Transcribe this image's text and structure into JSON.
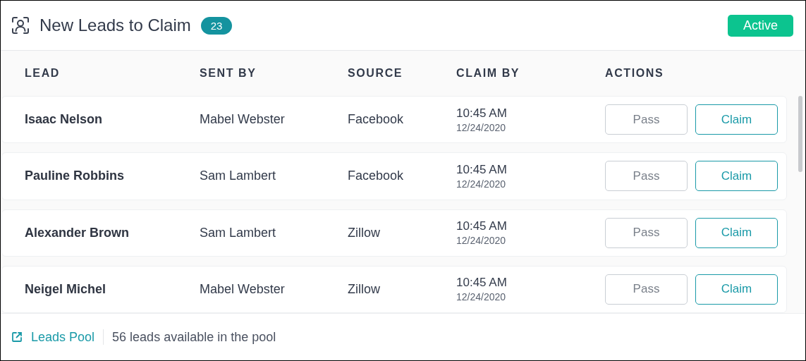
{
  "header": {
    "title": "New Leads to Claim",
    "count": "23",
    "status": "Active"
  },
  "table": {
    "columns": [
      "LEAD",
      "SENT BY",
      "SOURCE",
      "CLAIM BY",
      "ACTIONS"
    ],
    "rows": [
      {
        "lead": "Isaac Nelson",
        "sent_by": "Mabel Webster",
        "source": "Facebook",
        "time": "10:45 AM",
        "date": "12/24/2020",
        "actions": [
          {
            "label": "Pass",
            "kind": "secondary"
          },
          {
            "label": "Claim",
            "kind": "primary"
          }
        ]
      },
      {
        "lead": "Pauline Robbins",
        "sent_by": "Sam Lambert",
        "source": "Facebook",
        "time": "10:45 AM",
        "date": "12/24/2020",
        "actions": [
          {
            "label": "Pass",
            "kind": "secondary"
          },
          {
            "label": "Claim",
            "kind": "primary"
          }
        ]
      },
      {
        "lead": "Alexander Brown",
        "sent_by": "Sam Lambert",
        "source": "Zillow",
        "time": "10:45 AM",
        "date": "12/24/2020",
        "actions": [
          {
            "label": "Pass",
            "kind": "secondary"
          },
          {
            "label": "Claim",
            "kind": "primary"
          }
        ]
      },
      {
        "lead": "Neigel Michel",
        "sent_by": "Mabel Webster",
        "source": "Zillow",
        "time": "10:45 AM",
        "date": "12/24/2020",
        "actions": [
          {
            "label": "Pass",
            "kind": "secondary"
          },
          {
            "label": "Claim",
            "kind": "primary"
          }
        ]
      }
    ]
  },
  "footer": {
    "link": "Leads Pool",
    "text": "56 leads available in the pool"
  }
}
